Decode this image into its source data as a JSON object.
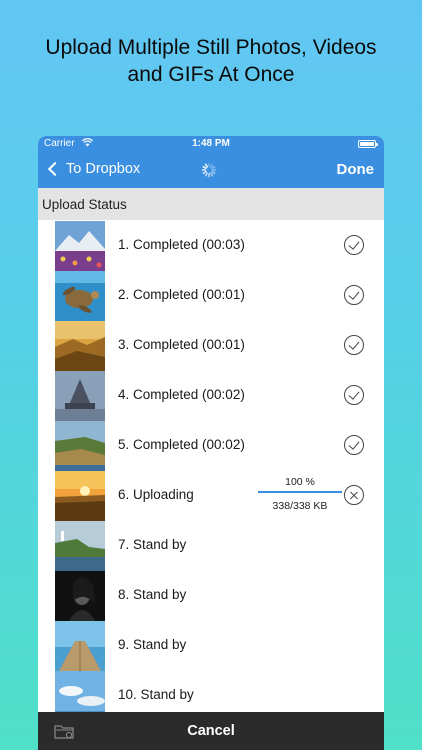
{
  "headline": {
    "line1": "Upload Multiple Still Photos, Videos",
    "line2": "and GIFs At Once"
  },
  "statusbar": {
    "carrier": "Carrier",
    "time": "1:48 PM",
    "wifi_icon": "wifi-icon",
    "battery_icon": "battery-icon"
  },
  "navbar": {
    "back_label": "To Dropbox",
    "done_label": "Done",
    "spinner_icon": "activity-spinner-icon"
  },
  "section_header": "Upload Status",
  "items": [
    {
      "label": "1. Completed (00:03)",
      "status": "completed",
      "thumb": "mountain-flowers"
    },
    {
      "label": "2. Completed (00:01)",
      "status": "completed",
      "thumb": "sea-turtle"
    },
    {
      "label": "3. Completed (00:01)",
      "status": "completed",
      "thumb": "golden-hills"
    },
    {
      "label": "4. Completed (00:02)",
      "status": "completed",
      "thumb": "mont-saint-michel"
    },
    {
      "label": "5. Completed (00:02)",
      "status": "completed",
      "thumb": "coastal-cliffs"
    },
    {
      "label": "6. Uploading",
      "status": "uploading",
      "thumb": "sunset-field",
      "progress_text": "100 %",
      "progress": 1.0,
      "size_text": "338/338 KB"
    },
    {
      "label": "7. Stand by",
      "status": "standby",
      "thumb": "cliff-lighthouse"
    },
    {
      "label": "8. Stand by",
      "status": "standby",
      "thumb": "portrait-bw"
    },
    {
      "label": "9. Stand by",
      "status": "standby",
      "thumb": "pier"
    },
    {
      "label": "10. Stand by",
      "status": "standby",
      "thumb": "sky-clouds"
    }
  ],
  "toolbar": {
    "cancel_label": "Cancel",
    "folder_icon": "folder-icon"
  },
  "colors": {
    "accent": "#3a8fe0",
    "toolbar": "#2b2b2b",
    "section": "#e3e3e3"
  }
}
